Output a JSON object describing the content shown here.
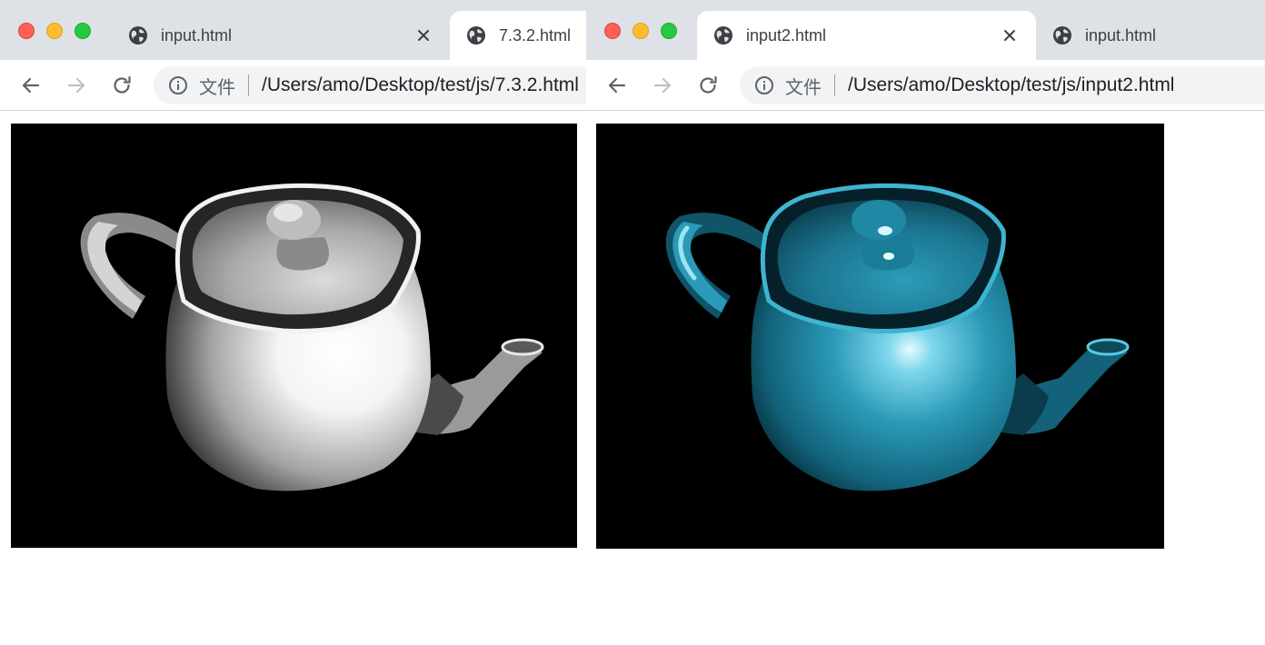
{
  "left_window": {
    "tabs": [
      {
        "title": "input.html",
        "active": false,
        "favicon": "globe-icon",
        "close": "close-icon"
      },
      {
        "title": "7.3.2.html",
        "active": true,
        "favicon": "globe-icon"
      }
    ],
    "address": {
      "scheme_label": "文件",
      "url": "/Users/amo/Desktop/test/js/7.3.2.html",
      "info_icon": "info-icon"
    },
    "nav": {
      "back_icon": "arrow-left-icon",
      "forward_icon": "arrow-right-icon",
      "reload_icon": "reload-icon"
    },
    "render": {
      "teapot_color": "#ffffff",
      "background": "#000000"
    }
  },
  "right_window": {
    "tabs": [
      {
        "title": "input2.html",
        "active": true,
        "favicon": "globe-icon",
        "close": "close-icon"
      },
      {
        "title": "input.html",
        "active": false,
        "favicon": "globe-icon"
      }
    ],
    "address": {
      "scheme_label": "文件",
      "url": "/Users/amo/Desktop/test/js/input2.html",
      "info_icon": "info-icon"
    },
    "nav": {
      "back_icon": "arrow-left-icon",
      "forward_icon": "arrow-right-icon",
      "reload_icon": "reload-icon"
    },
    "render": {
      "teapot_color": "#2a9ab8",
      "background": "#000000"
    }
  },
  "colors": {
    "tabstrip": "#dee1e6",
    "traffic_close": "#fe5f57",
    "traffic_minimize": "#febc2e",
    "traffic_maximize": "#28c840"
  }
}
